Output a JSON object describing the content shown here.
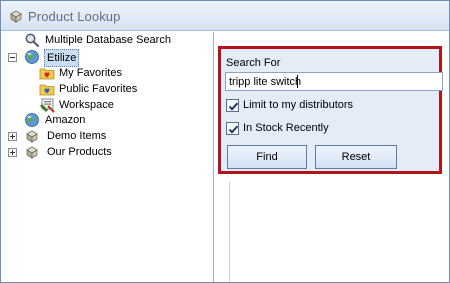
{
  "window": {
    "title": "Product Lookup"
  },
  "tree": {
    "items": [
      {
        "label": "Multiple Database Search",
        "icon": "magnifier-icon"
      },
      {
        "label": "Etilize",
        "icon": "globe-icon",
        "expanded": true,
        "selected": true
      },
      {
        "label": "My Favorites",
        "icon": "favorites-folder-icon"
      },
      {
        "label": "Public Favorites",
        "icon": "public-favorites-folder-icon"
      },
      {
        "label": "Workspace",
        "icon": "workspace-icon"
      },
      {
        "label": "Amazon",
        "icon": "globe-icon"
      },
      {
        "label": "Demo Items",
        "icon": "database-icon",
        "expanded": false
      },
      {
        "label": "Our Products",
        "icon": "database-icon",
        "expanded": false
      }
    ]
  },
  "search": {
    "label": "Search For",
    "value": "tripp lite switch",
    "limit_distributors": {
      "label": "Limit to my distributors",
      "checked": true
    },
    "in_stock": {
      "label": "In Stock Recently",
      "checked": true
    },
    "find_label": "Find",
    "reset_label": "Reset"
  },
  "colors": {
    "highlight_border": "#b3131a",
    "panel_bg": "#e4ecf7",
    "title_text": "#5c6f86"
  }
}
